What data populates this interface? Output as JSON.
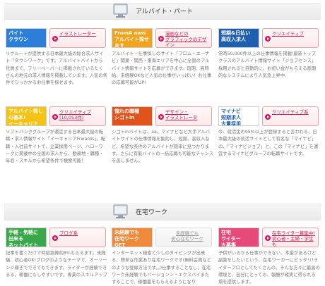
{
  "sections": [
    {
      "title": "アルバイト・パート"
    },
    {
      "title": "在宅ワーク"
    }
  ],
  "cards": [
    {
      "thumb": "バイト\nクラウン",
      "thumb_bg": "#2c7fd9",
      "btn": "イラストレーター",
      "desc": "リクルートが提供する日本最大級の総合求人サイト「タウンワーク」です。アルバイトバイトから社員まで、フリーペーパーに掲載されているたくさんの地元の求人情報を掲載しています。人気の条件でひっかかるお仕事を探せます。"
    },
    {
      "thumb": "FromA navi\nアルバイト探せます",
      "thumb_bg": "#f3a21b",
      "btn": "漫画などの\nグラフィックのデザイン\nWEBデザイナー",
      "desc": "アルバイト・仕事探しのサイト「フロム・エーナビ」関東・関西・東海エリアを中心に全国のアルバイト情報サイトを応募ができます。短期、高時給、未経験OKなど人気の仕事がいっぱい！お仕事の応募可能がUP!"
    },
    {
      "thumb": "短期&日払い\n高収入求人",
      "thumb_bg": "#1f5fb0",
      "btn": "クリエイティブ",
      "desc": "常時50,000件以上の仕事情報を掲載!最新トップクラスのアルバイト情報サイト「ジョブセンス」採用されると自動的に、お祝い金がもらえる画期的なシステムにより人気急上昇中."
    },
    {
      "thumb": "アルバイト探しの基本!\nイーキャリア",
      "thumb_bg": "#f7c211",
      "btn": "クリエイティブ\n(10,053件)",
      "desc": "ソフトバンクグループが運営する日本最大級の転職・求人情報サイト「イーキャリアFrwards」。転職・入社前サイトで、企業採用ページ、ハローワークに掲載中の全国の求人から、勤務地・職種・年収・スキルから希望条件で検索可能！"
    },
    {
      "thumb": "憧れの職種\nシゴトin",
      "thumb_bg": "#e2531b",
      "btn": "デザイン・\nイラストレータ",
      "desc": "シゴトinバイトは、aa、マイナビなど大手アルバイトサイトの仕事情報を集約し、短期、高収入など、希望な条件のアルバイトが簡単に見つかります。さらに有能バイトの一括応募も可能なチャンスを逃しません。"
    },
    {
      "thumb": "マイナビ\n短期求人\n大量採用",
      "thumb_bg": "#ffffff",
      "btn": "クリエイティブ系",
      "desc": "今、就活生の95%以上が登録すると言われる、日本最大級の就活サイトとして有名な「マイナビ」の、「マイナビジョブ」と、この「マイナビ」を運営するマイナビグループの転職サイトです。"
    },
    {
      "thumb": "手軽・気軽に\n出来る\nネットバイト",
      "thumb_bg": "#3aa84a",
      "btn": "ブログ系",
      "desc": "記事を書くだけで時給換算約8%もらえます。未経験、初心者OK!ブログのようなテーマで、オーソーンジ稼ぎでできてもできます。ライターが経験できるる。稼働にもしやすいです。専業のスキルアップ"
    },
    {
      "thumb": "未経験でも\n在宅ワーク\nGET",
      "thumb_bg": "#f08a3a",
      "btn": "",
      "desc": "インターネット検索と少しのタイピングが出来る、簡単な作業あり在宅ワークです(無料会員などのような登録方法です。。)仕事することなし、在宅ワーク未経験でもバーションン・エクスバイまたすることで、稼働量をもらえるようになり"
    },
    {
      "thumb": "在宅\nライター\n大募集",
      "thumb_bg": "#e64a78",
      "btn": "在宅ライター募集中!\n初心者・主婦・学生も\n大歓迎！",
      "desc": "子供がいるから仕事ができない、本業があるけど副業をしたいという、在宅ワーカーにピッタリ!ライタープロとしてたくさんの、そんな方々に最高の環境と、自分にとっての、報酬が確実に得られる場を提供します。"
    }
  ],
  "gray_btn": "未経験でも\n安心在宅ワーク"
}
